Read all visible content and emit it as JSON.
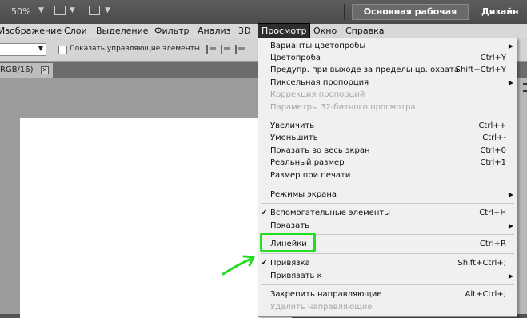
{
  "app_bar": {
    "zoom": "50%",
    "workspace_button": "Основная рабочая среда",
    "design": "Дизайн"
  },
  "menubar": [
    {
      "label": "Изображение"
    },
    {
      "label": "Слои"
    },
    {
      "label": "Выделение"
    },
    {
      "label": "Фильтр"
    },
    {
      "label": "Анализ"
    },
    {
      "label": "3D"
    },
    {
      "label": "Просмотр",
      "active": true
    },
    {
      "label": "Окно"
    },
    {
      "label": "Справка"
    }
  ],
  "options_bar": {
    "show_controls_label": "Показать управляющие элементы"
  },
  "document_tab": {
    "title": "RGB/16)",
    "close": "✕"
  },
  "view_menu": {
    "items": [
      {
        "label": "Варианты цветопробы",
        "shortcut": "",
        "submenu": true,
        "checked": false,
        "disabled": false
      },
      {
        "label": "Цветопроба",
        "shortcut": "Ctrl+Y",
        "submenu": false,
        "checked": false,
        "disabled": false
      },
      {
        "label": "Предупр. при выходе за пределы цв. охвата",
        "shortcut": "Shift+Ctrl+Y",
        "submenu": false,
        "checked": false,
        "disabled": false
      },
      {
        "label": "Пиксельная пропорция",
        "shortcut": "",
        "submenu": true,
        "checked": false,
        "disabled": false
      },
      {
        "label": "Коррекция пропорций",
        "shortcut": "",
        "submenu": false,
        "checked": false,
        "disabled": true
      },
      {
        "label": "Параметры 32-битного просмотра...",
        "shortcut": "",
        "submenu": false,
        "checked": false,
        "disabled": true
      },
      {
        "label": "Увеличить",
        "shortcut": "Ctrl++",
        "submenu": false,
        "checked": false,
        "disabled": false
      },
      {
        "label": "Уменьшить",
        "shortcut": "Ctrl+-",
        "submenu": false,
        "checked": false,
        "disabled": false
      },
      {
        "label": "Показать во весь экран",
        "shortcut": "Ctrl+0",
        "submenu": false,
        "checked": false,
        "disabled": false
      },
      {
        "label": "Реальный размер",
        "shortcut": "Ctrl+1",
        "submenu": false,
        "checked": false,
        "disabled": false
      },
      {
        "label": "Размер при печати",
        "shortcut": "",
        "submenu": false,
        "checked": false,
        "disabled": false
      },
      {
        "label": "Режимы экрана",
        "shortcut": "",
        "submenu": true,
        "checked": false,
        "disabled": false
      },
      {
        "label": "Вспомогательные элементы",
        "shortcut": "Ctrl+H",
        "submenu": false,
        "checked": true,
        "disabled": false
      },
      {
        "label": "Показать",
        "shortcut": "",
        "submenu": true,
        "checked": false,
        "disabled": false
      },
      {
        "label": "Линейки",
        "shortcut": "Ctrl+R",
        "submenu": false,
        "checked": false,
        "disabled": false
      },
      {
        "label": "Привязка",
        "shortcut": "Shift+Ctrl+;",
        "submenu": false,
        "checked": true,
        "disabled": false
      },
      {
        "label": "Привязать к",
        "shortcut": "",
        "submenu": true,
        "checked": false,
        "disabled": false
      },
      {
        "label": "Закрепить направляющие",
        "shortcut": "Alt+Ctrl+;",
        "submenu": false,
        "checked": false,
        "disabled": false
      },
      {
        "label": "Удалить направляющие",
        "shortcut": "",
        "submenu": false,
        "checked": false,
        "disabled": true
      }
    ],
    "check_glyph": "✔",
    "submenu_glyph": "▶"
  },
  "annotation": {
    "highlight_color": "#22dd22"
  }
}
